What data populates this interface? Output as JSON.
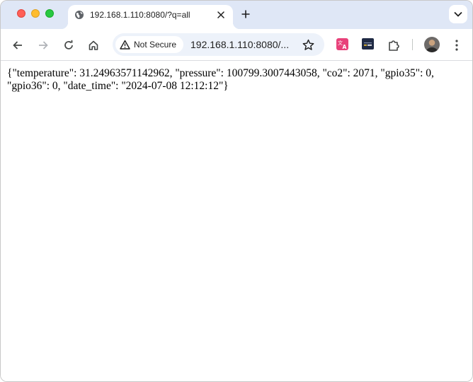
{
  "browser": {
    "tab": {
      "title": "192.168.1.110:8080/?q=all",
      "favicon": "globe-icon"
    },
    "toolbar": {
      "security_label": "Not Secure",
      "url_display": "192.168.1.110:8080/...",
      "icons": [
        "back-arrow-icon",
        "forward-arrow-icon",
        "reload-icon",
        "home-icon",
        "warning-triangle-icon",
        "star-icon",
        "translate-extension-icon",
        "panel-extension-icon",
        "puzzle-icon",
        "avatar",
        "kebab-menu-icon"
      ]
    },
    "colors": {
      "tabstrip": "#dfe7f6",
      "omnibox": "#edf2fa",
      "translate_ext": "#e8417a"
    }
  },
  "page": {
    "body_text": "{\"temperature\": 31.24963571142962, \"pressure\": 100799.3007443058, \"co2\": 2071, \"gpio35\": 0, \"gpio36\": 0, \"date_time\": \"2024-07-08 12:12:12\"}"
  }
}
